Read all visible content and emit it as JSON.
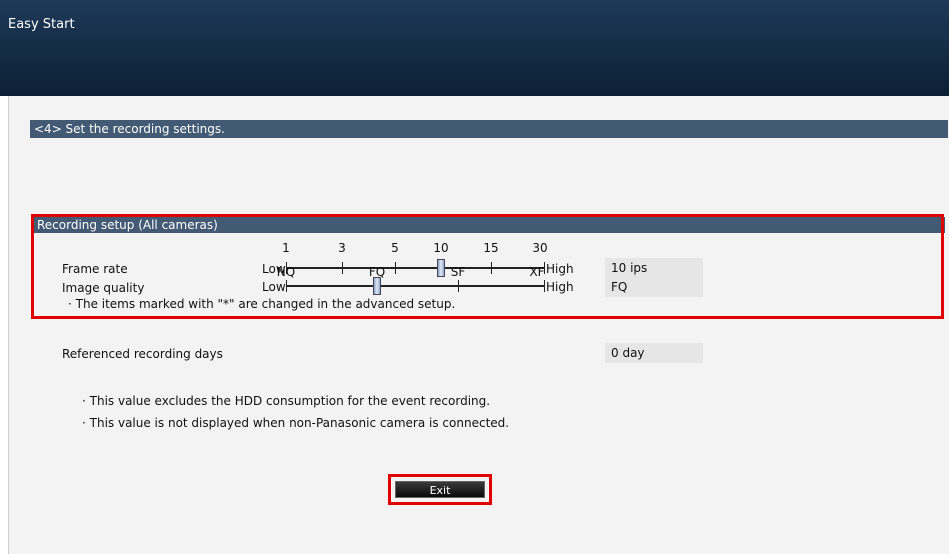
{
  "window": {
    "title": "Easy Start"
  },
  "step": {
    "title": "<4> Set the recording settings."
  },
  "recording_setup": {
    "section_title": "Recording setup (All cameras)",
    "frame_rate": {
      "label": "Frame rate",
      "low_label": "Low",
      "high_label": "High",
      "ticks": [
        "1",
        "3",
        "5",
        "10",
        "15",
        "30"
      ],
      "selected": "10",
      "value": "10 ips"
    },
    "image_quality": {
      "label": "Image quality",
      "low_label": "Low",
      "high_label": "High",
      "ticks": [
        "NQ",
        "FQ",
        "SF",
        "XF"
      ],
      "selected": "FQ",
      "value": "FQ"
    },
    "note": "· The items marked with \"*\" are changed in the advanced setup."
  },
  "referenced_days": {
    "label": "Referenced recording days",
    "value": "0 day"
  },
  "notes": [
    "· This value excludes the HDD consumption for the event recording.",
    "· This value is not displayed when non-Panasonic camera is connected."
  ],
  "exit_button": {
    "label": "Exit"
  },
  "colors": {
    "titlebar": "#0c2035",
    "section_bar": "#425a74",
    "highlight": "#e00000",
    "panel": "#f3f3f3"
  }
}
